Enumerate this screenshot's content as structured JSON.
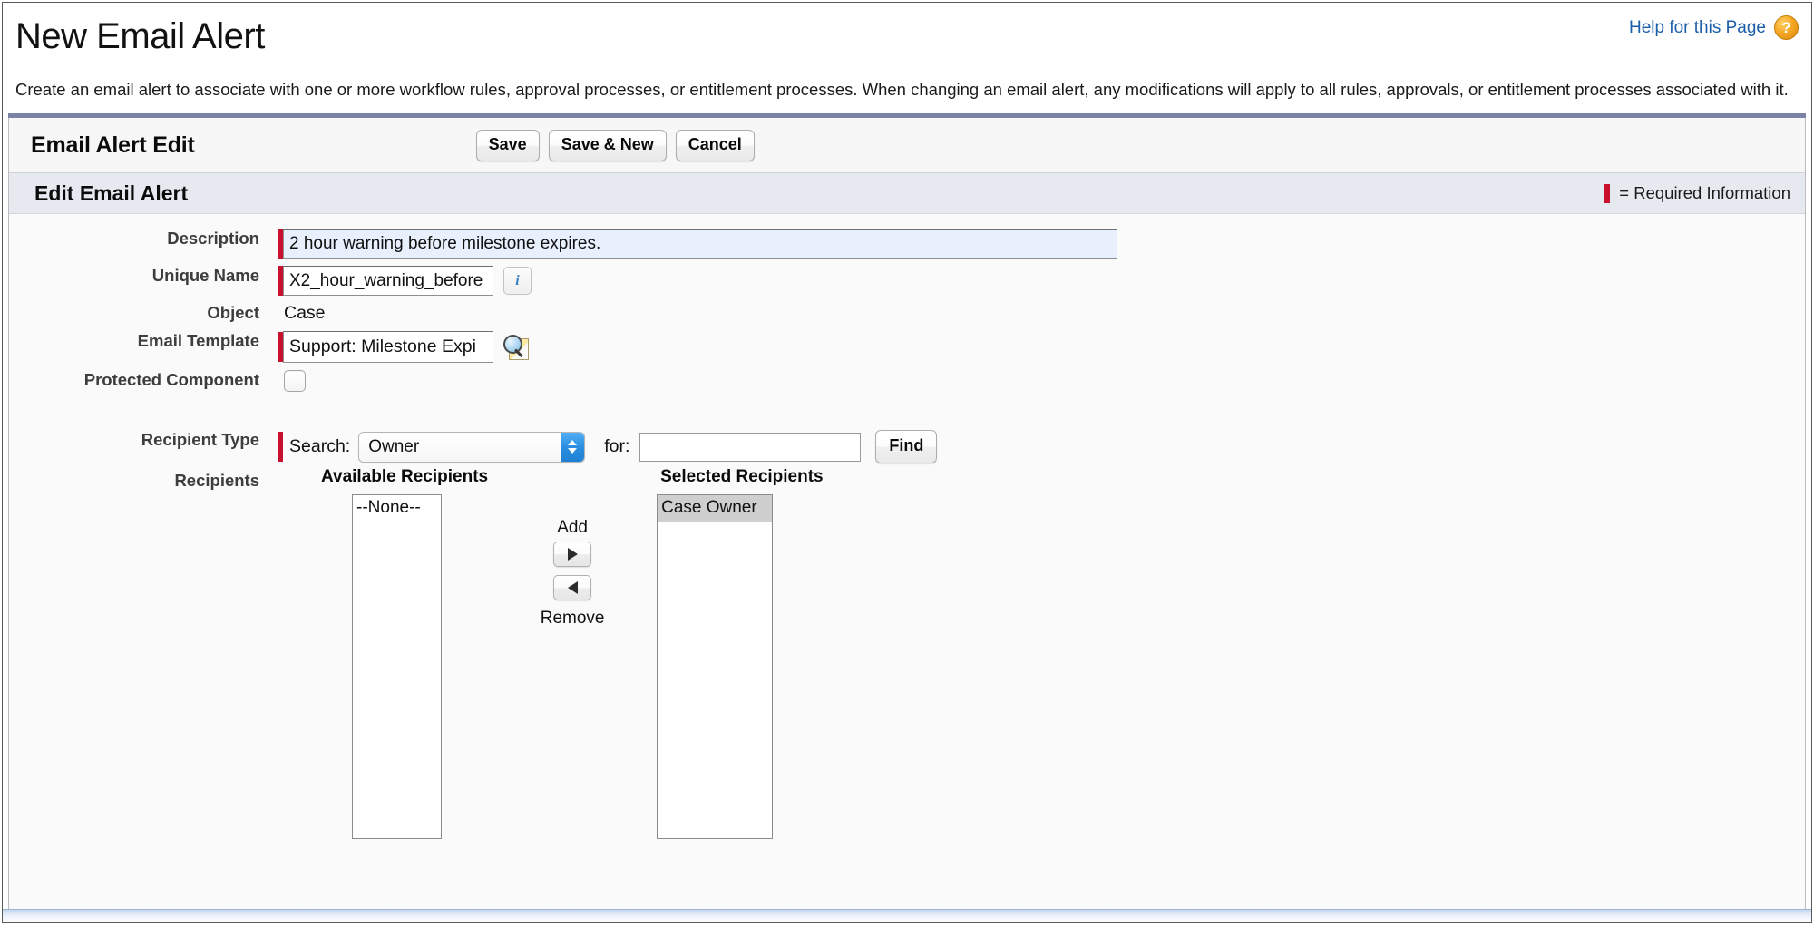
{
  "header": {
    "title": "New Email Alert",
    "help_link": "Help for this Page",
    "help_icon_glyph": "?",
    "description": "Create an email alert to associate with one or more workflow rules, approval processes, or entitlement processes. When changing an email alert, any modifications will apply to all rules, approvals, or entitlement processes associated with it."
  },
  "toolbar": {
    "title": "Email Alert Edit",
    "save_label": "Save",
    "save_new_label": "Save & New",
    "cancel_label": "Cancel"
  },
  "section": {
    "title": "Edit Email Alert",
    "required_legend": "= Required Information"
  },
  "form": {
    "description": {
      "label": "Description",
      "value": "2 hour warning before milestone expires.",
      "required": true
    },
    "unique_name": {
      "label": "Unique Name",
      "value": "X2_hour_warning_before",
      "required": true,
      "info_glyph": "i"
    },
    "object": {
      "label": "Object",
      "value": "Case",
      "required": false
    },
    "email_template": {
      "label": "Email Template",
      "value": "Support: Milestone Expi",
      "required": true,
      "lookup_icon": "lookup-icon"
    },
    "protected_component": {
      "label": "Protected Component",
      "checked": false
    },
    "recipient_type": {
      "label": "Recipient Type",
      "search_label": "Search:",
      "selected_option": "Owner",
      "options": [
        "Owner"
      ],
      "for_label": "for:",
      "for_value": "",
      "find_label": "Find",
      "required": true
    },
    "recipients": {
      "label": "Recipients",
      "available_header": "Available Recipients",
      "available_items": [
        "--None--"
      ],
      "selected_header": "Selected Recipients",
      "selected_items": [
        "Case Owner"
      ],
      "selected_highlighted": "Case Owner",
      "add_label": "Add",
      "remove_label": "Remove"
    }
  },
  "colors": {
    "required_red": "#c8102e",
    "link_blue": "#1c5fa8",
    "section_band": "#e6e9f0",
    "panel_top_border": "#7b83a5",
    "autofill_blue": "#e8f0fe",
    "stepper_blue": "#2a8ee0"
  }
}
